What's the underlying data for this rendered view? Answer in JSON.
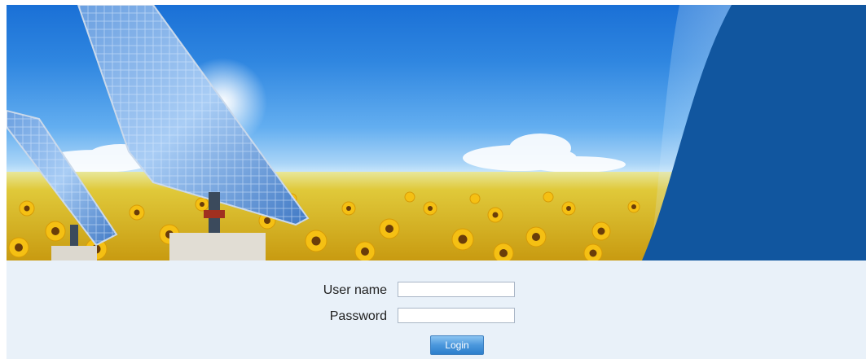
{
  "banner": {
    "image": "solar-panels-in-sunflower-field-illustration",
    "colors": {
      "sky_top": "#1a70d6",
      "sky_horizon": "#eef8ff",
      "swoosh": "#11569f",
      "field": "#f6c417"
    }
  },
  "login": {
    "username_label": "User name",
    "username_value": "",
    "password_label": "Password",
    "password_value": "",
    "login_button": "Login",
    "colors": {
      "panel_bg": "#e9f1f9",
      "button": "#3d8dd6"
    }
  }
}
